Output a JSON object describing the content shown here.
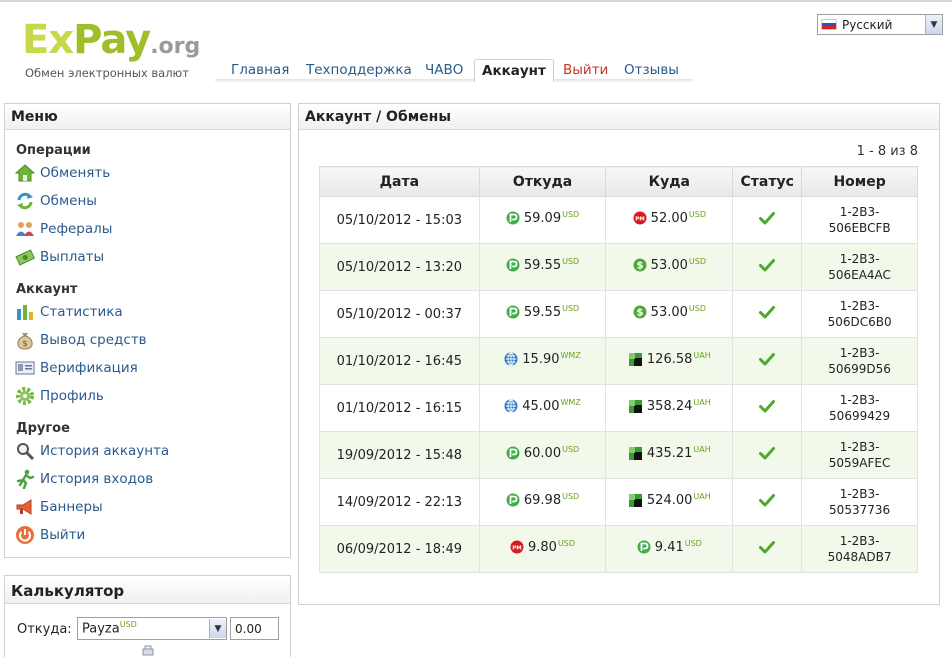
{
  "brand": {
    "logo_ex": "Ex",
    "logo_pay": "Pay",
    "logo_org": ".org",
    "tagline": "Обмен электронных валют"
  },
  "language": {
    "selected": "Русский"
  },
  "nav": [
    {
      "label": "Главная",
      "active": false
    },
    {
      "label": "Техподдержка",
      "active": false
    },
    {
      "label": "ЧАВО",
      "active": false
    },
    {
      "label": "Аккаунт",
      "active": true
    },
    {
      "label": "Выйти",
      "active": false
    },
    {
      "label": "Отзывы",
      "active": false
    }
  ],
  "menu": {
    "title": "Меню",
    "sections": [
      {
        "title": "Операции",
        "items": [
          {
            "label": "Обменять",
            "icon": "home-icon"
          },
          {
            "label": "Обмены",
            "icon": "refresh-icon"
          },
          {
            "label": "Рефералы",
            "icon": "users-icon"
          },
          {
            "label": "Выплаты",
            "icon": "money-icon"
          }
        ]
      },
      {
        "title": "Аккаунт",
        "items": [
          {
            "label": "Статистика",
            "icon": "bar-chart-icon"
          },
          {
            "label": "Вывод средств",
            "icon": "money-bag-icon"
          },
          {
            "label": "Верификация",
            "icon": "id-card-icon"
          },
          {
            "label": "Профиль",
            "icon": "gear-icon"
          }
        ]
      },
      {
        "title": "Другое",
        "items": [
          {
            "label": "История аккаунта",
            "icon": "magnifier-icon"
          },
          {
            "label": "История входов",
            "icon": "running-man-icon"
          },
          {
            "label": "Баннеры",
            "icon": "megaphone-icon"
          },
          {
            "label": "Выйти",
            "icon": "power-icon"
          }
        ]
      }
    ]
  },
  "calculator": {
    "title": "Калькулятор",
    "from_label": "Откуда:",
    "from_value": "Payza",
    "from_currency": "USD",
    "amount": "0.00"
  },
  "main": {
    "title": "Аккаунт / Обмены",
    "pager": "1 - 8 из 8",
    "columns": [
      "Дата",
      "Откуда",
      "Куда",
      "Статус",
      "Номер"
    ],
    "rows": [
      {
        "date": "05/10/2012 - 15:03",
        "from_amount": "59.09",
        "from_cur": "USD",
        "from_sys": "payza",
        "to_amount": "52.00",
        "to_cur": "USD",
        "to_sys": "perfectmoney",
        "num1": "1-2B3-",
        "num2": "506EBCFB"
      },
      {
        "date": "05/10/2012 - 13:20",
        "from_amount": "59.55",
        "from_cur": "USD",
        "from_sys": "payza",
        "to_amount": "53.00",
        "to_cur": "USD",
        "to_sys": "dollar",
        "num1": "1-2B3-",
        "num2": "506EA4AC"
      },
      {
        "date": "05/10/2012 - 00:37",
        "from_amount": "59.55",
        "from_cur": "USD",
        "from_sys": "payza",
        "to_amount": "53.00",
        "to_cur": "USD",
        "to_sys": "dollar",
        "num1": "1-2B3-",
        "num2": "506DC6B0"
      },
      {
        "date": "01/10/2012 - 16:45",
        "from_amount": "15.90",
        "from_cur": "WMZ",
        "from_sys": "webmoney",
        "to_amount": "126.58",
        "to_cur": "UAH",
        "to_sys": "privat",
        "num1": "1-2B3-",
        "num2": "50699D56"
      },
      {
        "date": "01/10/2012 - 16:15",
        "from_amount": "45.00",
        "from_cur": "WMZ",
        "from_sys": "webmoney",
        "to_amount": "358.24",
        "to_cur": "UAH",
        "to_sys": "privat",
        "num1": "1-2B3-",
        "num2": "50699429"
      },
      {
        "date": "19/09/2012 - 15:48",
        "from_amount": "60.00",
        "from_cur": "USD",
        "from_sys": "payza",
        "to_amount": "435.21",
        "to_cur": "UAH",
        "to_sys": "privat",
        "num1": "1-2B3-",
        "num2": "5059AFEC"
      },
      {
        "date": "14/09/2012 - 22:13",
        "from_amount": "69.98",
        "from_cur": "USD",
        "from_sys": "payza",
        "to_amount": "524.00",
        "to_cur": "UAH",
        "to_sys": "privat",
        "num1": "1-2B3-",
        "num2": "50537736"
      },
      {
        "date": "06/09/2012 - 18:49",
        "from_amount": "9.80",
        "from_cur": "USD",
        "from_sys": "perfectmoney",
        "to_amount": "9.41",
        "to_cur": "USD",
        "to_sys": "payza",
        "num1": "1-2B3-",
        "num2": "5048ADB7"
      }
    ]
  }
}
